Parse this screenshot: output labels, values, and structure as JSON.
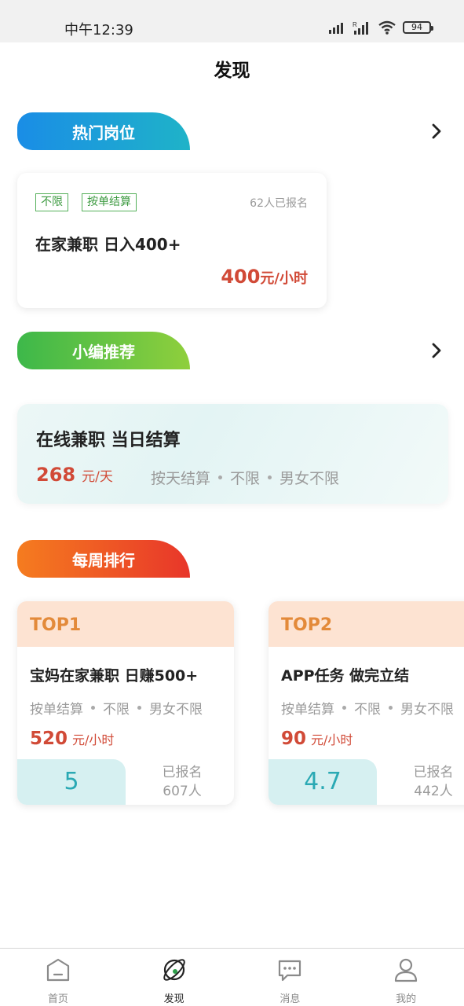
{
  "status_bar": {
    "time": "中午12:39",
    "battery": "94"
  },
  "page": {
    "title": "发现"
  },
  "sections": {
    "hot": {
      "label": "热门岗位",
      "gradient": [
        "#1a8de6",
        "#1fb3c8"
      ]
    },
    "recommend": {
      "label": "小编推荐",
      "gradient": [
        "#3db84a",
        "#8fcf3c"
      ]
    },
    "weekly": {
      "label": "每周排行",
      "gradient": [
        "#f57c1f",
        "#e8362a"
      ]
    }
  },
  "hot_job": {
    "tags": [
      "不限",
      "按单结算"
    ],
    "signups": "62人已报名",
    "title": "在家兼职 日入400+",
    "price_num": "400",
    "price_unit": "元/小时"
  },
  "recommend_job": {
    "title": "在线兼职 当日结算",
    "price_num": "268",
    "price_unit": "元/天",
    "meta": [
      "按天结算",
      "不限",
      "男女不限"
    ]
  },
  "weekly_ranking": [
    {
      "rank": "TOP1",
      "title": "宝妈在家兼职 日赚500+",
      "meta": [
        "按单结算",
        "不限",
        "男女不限"
      ],
      "price_num": "520",
      "price_unit": "元/小时",
      "score": "5",
      "signups_label": "已报名",
      "signups_count": "607人"
    },
    {
      "rank": "TOP2",
      "title": "APP任务 做完立结",
      "meta": [
        "按单结算",
        "不限",
        "男女不限"
      ],
      "price_num": "90",
      "price_unit": "元/小时",
      "score": "4.7",
      "signups_label": "已报名",
      "signups_count": "442人"
    }
  ],
  "tab_bar": [
    {
      "label": "首页",
      "icon": "home-icon"
    },
    {
      "label": "发现",
      "icon": "discover-icon",
      "active": true
    },
    {
      "label": "消息",
      "icon": "message-icon"
    },
    {
      "label": "我的",
      "icon": "profile-icon"
    }
  ],
  "colors": {
    "price_red": "#d14a37",
    "tag_green": "#3c9a40",
    "rank_orange": "#e38a3a",
    "score_teal": "#2aa9b4"
  }
}
